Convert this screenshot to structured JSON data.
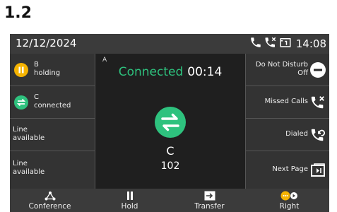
{
  "heading": "1.2",
  "topbar": {
    "date": "12/12/2024",
    "time": "14:08"
  },
  "left_keys": [
    {
      "line1": "B",
      "line2": "holding",
      "icon": "hold-icon"
    },
    {
      "line1": "C",
      "line2": "connected",
      "icon": "transfer-icon"
    },
    {
      "line1": "Line",
      "line2": "available"
    },
    {
      "line1": "Line",
      "line2": "available"
    }
  ],
  "right_keys": [
    {
      "line1": "Do Not Disturb",
      "line2": "Off",
      "icon": "dnd-icon"
    },
    {
      "line1": "Missed Calls",
      "icon": "missed-call-icon"
    },
    {
      "line1": "Dialed",
      "icon": "dialed-call-icon"
    },
    {
      "line1": "Next Page",
      "icon": "next-page-icon"
    }
  ],
  "call": {
    "line_letter": "A",
    "status": "Connected",
    "duration": "00:14",
    "party_name": "C",
    "party_number": "102"
  },
  "softkeys": [
    {
      "label": "Conference",
      "icon": "conference-icon"
    },
    {
      "label": "Hold",
      "icon": "pause-icon"
    },
    {
      "label": "Transfer",
      "icon": "transfer-arrow-icon"
    },
    {
      "label": "Right",
      "icon": "more-icon"
    }
  ],
  "colors": {
    "accent_green": "#2ec27e",
    "hold_yellow": "#f5b301",
    "screen_bg": "#2a2a2a"
  }
}
